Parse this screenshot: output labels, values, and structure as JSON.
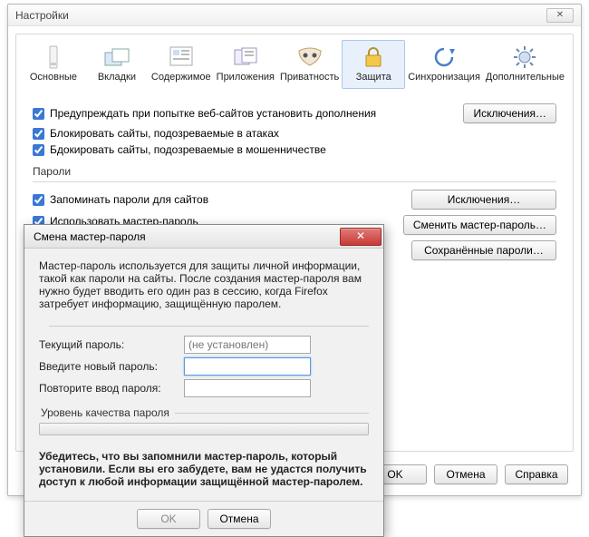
{
  "window": {
    "title": "Настройки"
  },
  "tabs": [
    {
      "label": "Основные"
    },
    {
      "label": "Вкладки"
    },
    {
      "label": "Содержимое"
    },
    {
      "label": "Приложения"
    },
    {
      "label": "Приватность"
    },
    {
      "label": "Защита"
    },
    {
      "label": "Синхронизация"
    },
    {
      "label": "Дополнительные"
    }
  ],
  "addons": {
    "warn_install": "Предупреждать при попытке веб-сайтов установить дополнения",
    "block_attack": "Блокировать сайты, подозреваемые в атаках",
    "block_fraud": "Бдокировать сайты, подозреваемые в мошенничестве",
    "exceptions_btn": "Исключения…"
  },
  "passwords": {
    "section_label": "Пароли",
    "remember": "Запоминать пароли для сайтов",
    "use_master": "Использовать мастер-пароль",
    "exceptions_btn": "Исключения…",
    "change_master_btn": "Сменить мастер-пароль…",
    "saved_btn": "Сохранённые пароли…"
  },
  "footer": {
    "ok": "OK",
    "cancel": "Отмена",
    "help": "Справка"
  },
  "modal": {
    "title": "Смена мастер-пароля",
    "desc": "Мастер-пароль используется для защиты личной информации, такой как пароли на сайты. После создания мастер-пароля вам нужно будет вводить его один раз в сессию, когда Firefox затребует информацию, защищённую паролем.",
    "current_label": "Текущий пароль:",
    "current_placeholder": "(не установлен)",
    "new_label": "Введите новый пароль:",
    "repeat_label": "Повторите ввод пароля:",
    "quality_label": "Уровень качества пароля",
    "warning": "Убедитесь, что вы запомнили мастер-пароль, который установили. Если вы его забудете, вам не удастся получить доступ к любой информации защищённой мастер-паролем.",
    "ok": "OK",
    "cancel": "Отмена"
  }
}
